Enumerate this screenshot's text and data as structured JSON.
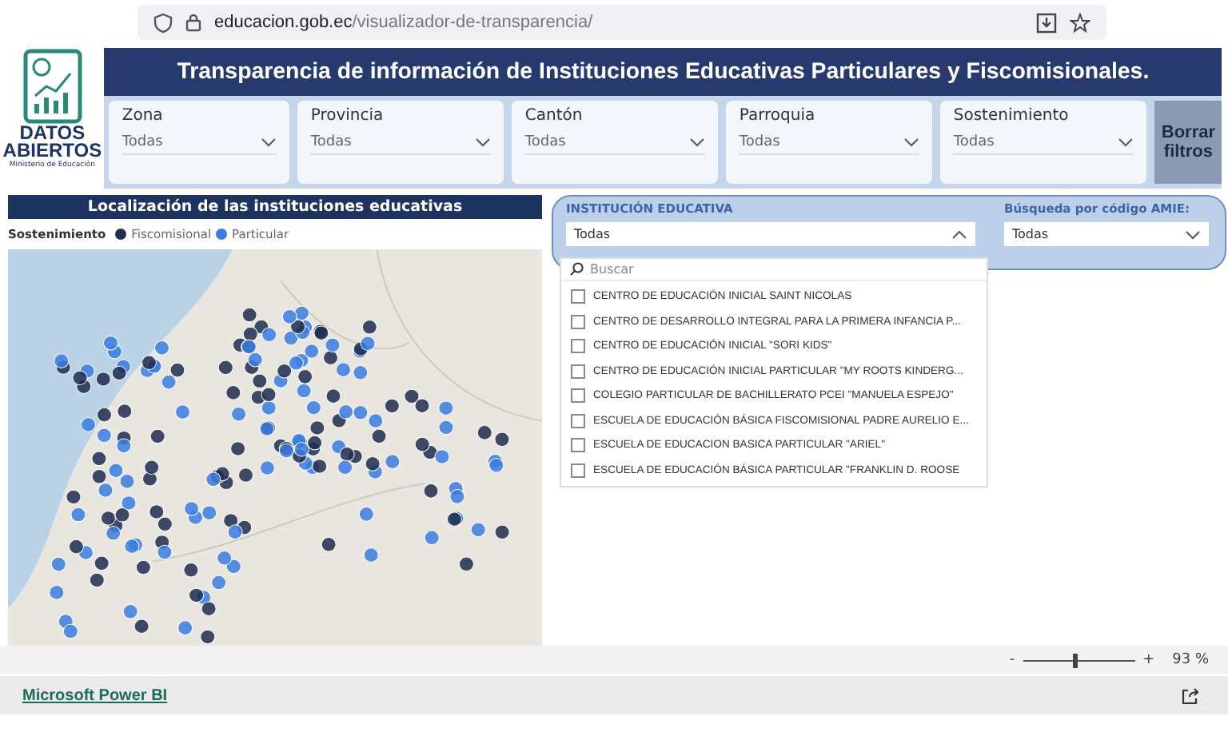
{
  "browser": {
    "url_host": "educacion.gob.ec",
    "url_path": "/visualizador-de-transparencia/"
  },
  "logo": {
    "title_line1": "DATOS",
    "title_line2": "ABIERTOS",
    "subtitle": "Ministerio de Educación"
  },
  "header": {
    "title": "Transparencia de información de Instituciones Educativas Particulares y Fiscomisionales."
  },
  "filters": [
    {
      "label": "Zona",
      "value": "Todas"
    },
    {
      "label": "Provincia",
      "value": "Todas"
    },
    {
      "label": "Cantón",
      "value": "Todas"
    },
    {
      "label": "Parroquia",
      "value": "Todas"
    },
    {
      "label": "Sostenimiento",
      "value": "Todas"
    }
  ],
  "clear_button": "Borrar filtros",
  "map_panel": {
    "title": "Localización de las instituciones educativas",
    "legend_title": "Sostenimiento",
    "legend": [
      {
        "label": "Fiscomisional",
        "color": "#1f2d4e"
      },
      {
        "label": "Particular",
        "color": "#3a7be0"
      }
    ]
  },
  "institution_slicer": {
    "label": "INSTITUCIÓN EDUCATIVA",
    "value": "Todas",
    "expanded": true,
    "search_placeholder": "Buscar",
    "items": [
      {
        "label": "CENTRO DE EDUCACIÓN INICIAL SAINT NICOLAS",
        "checked": false
      },
      {
        "label": "CENTRO DE DESARROLLO INTEGRAL PARA LA PRIMERA INFANCIA P...",
        "checked": false
      },
      {
        "label": "CENTRO DE EDUCACIÓN INICIAL \"SORI KIDS\"",
        "checked": false
      },
      {
        "label": "CENTRO DE EDUCACIÓN INICIAL PARTICULAR \"MY ROOTS KINDERG...",
        "checked": false
      },
      {
        "label": "COLEGIO PARTICULAR DE BACHILLERATO PCEI \"MANUELA ESPEJO\"",
        "checked": false
      },
      {
        "label": "ESCUELA DE EDUCACIÓN BÁSICA FISCOMISIONAL PADRE AURELIO E...",
        "checked": false
      },
      {
        "label": "ESCUELA DE EDUCACION BASICA PARTICULAR \"ARIEL\"",
        "checked": false
      },
      {
        "label": "ESCUELA DE EDUCACIÓN BÁSICA PARTICULAR \"FRANKLIN D. ROOSE",
        "checked": false
      }
    ]
  },
  "amie_slicer": {
    "label": "Búsqueda por código AMIE:",
    "value": "Todas"
  },
  "zoom": {
    "minus": "-",
    "plus": "+",
    "level": 0.47,
    "percent": "93 %"
  },
  "footer": {
    "link": "Microsoft Power BI"
  }
}
